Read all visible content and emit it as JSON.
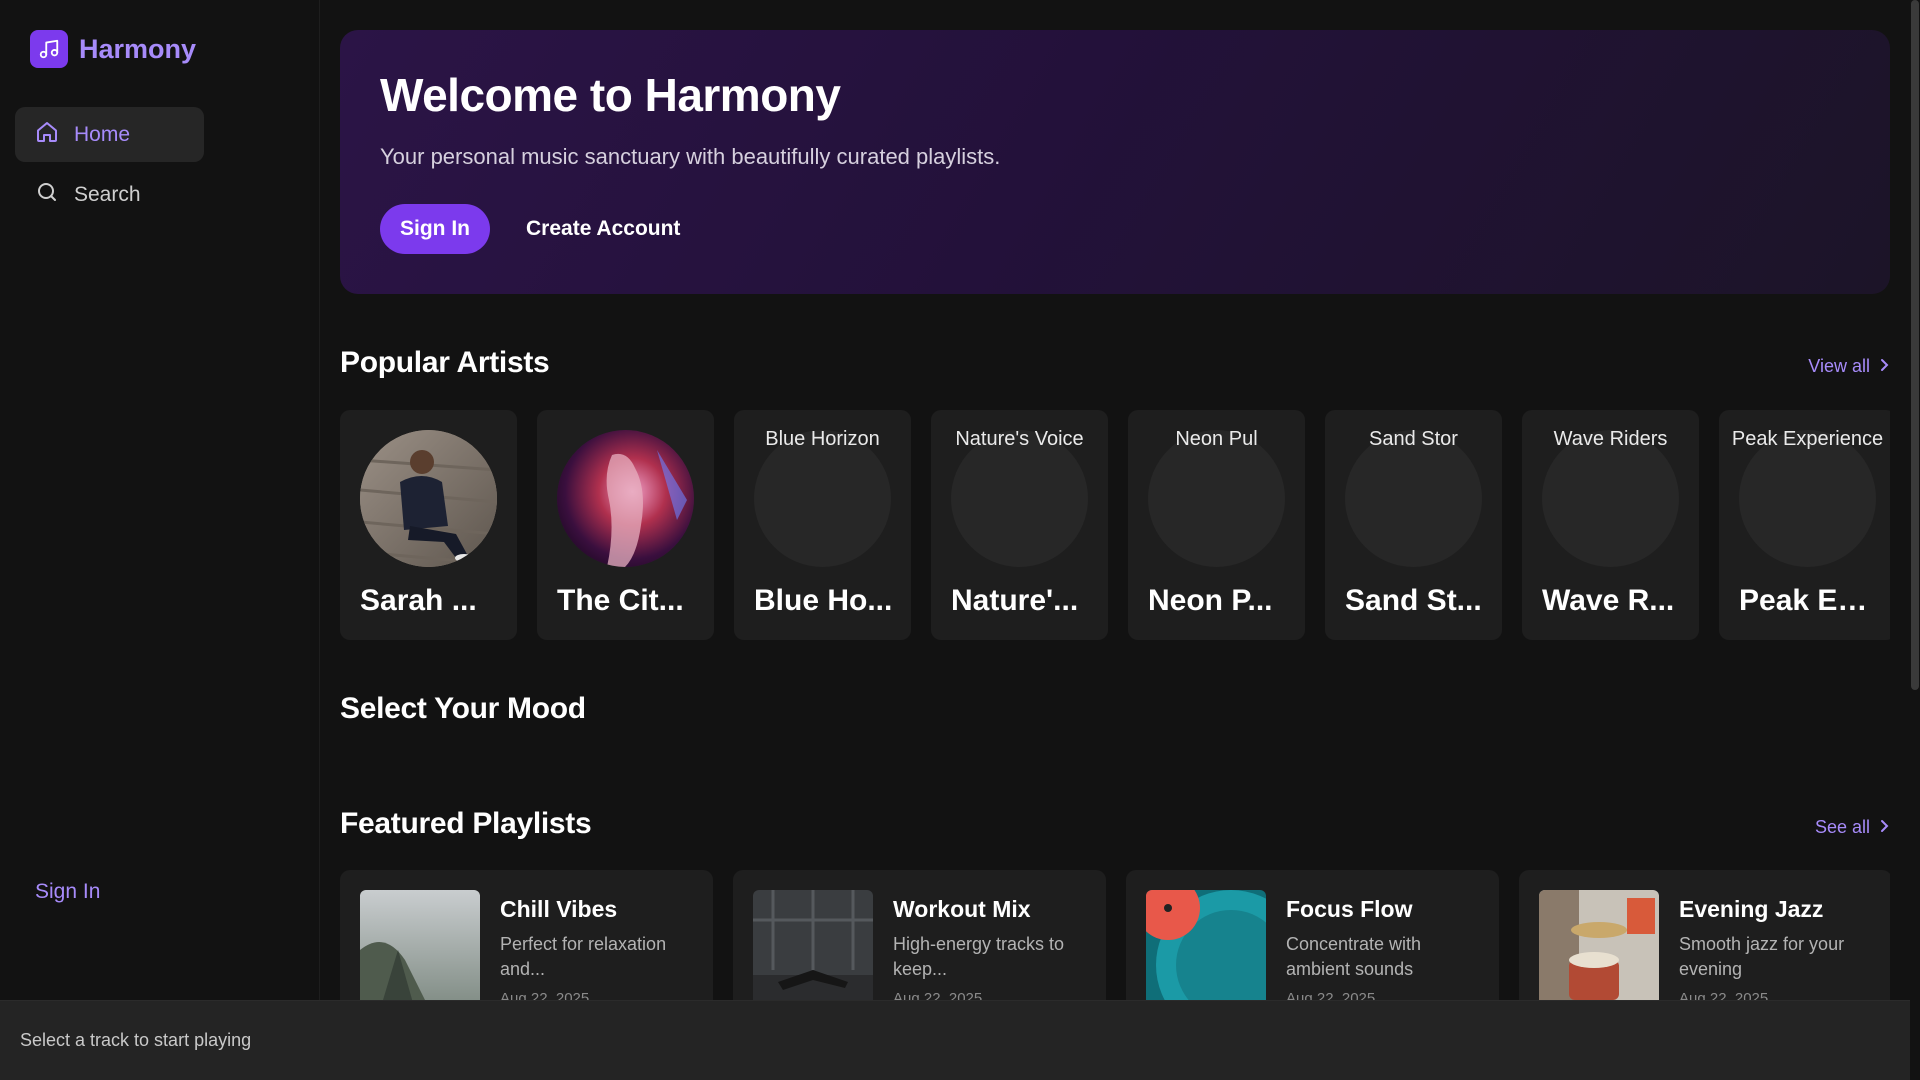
{
  "brand": {
    "name": "Harmony",
    "icon": "music-note-icon",
    "accent": "#7c3aed",
    "accent_light": "#a78bfa"
  },
  "sidebar": {
    "nav": [
      {
        "label": "Home",
        "icon": "home-icon",
        "active": true
      },
      {
        "label": "Search",
        "icon": "search-icon",
        "active": false
      }
    ],
    "signin_label": "Sign In"
  },
  "hero": {
    "title": "Welcome to Harmony",
    "subtitle": "Your personal music sanctuary with beautifully curated playlists.",
    "primary_button": "Sign In",
    "secondary_button": "Create Account"
  },
  "popular_artists": {
    "title": "Popular Artists",
    "link_label": "View all",
    "artists": [
      {
        "name": "Sarah ...",
        "image_alt": "",
        "has_image": true
      },
      {
        "name": "The Cit...",
        "image_alt": "",
        "has_image": true
      },
      {
        "name": "Blue Ho...",
        "image_alt": "Blue Horizon",
        "has_image": false
      },
      {
        "name": "Nature'...",
        "image_alt": "Nature's Voice",
        "has_image": false
      },
      {
        "name": "Neon P...",
        "image_alt": "Neon Pul",
        "has_image": false
      },
      {
        "name": "Sand St...",
        "image_alt": "Sand Stor",
        "has_image": false
      },
      {
        "name": "Wave R...",
        "image_alt": "Wave Riders",
        "has_image": false
      },
      {
        "name": "Peak Ex...",
        "image_alt": "Peak Experience",
        "has_image": false
      }
    ]
  },
  "mood": {
    "title": "Select Your Mood"
  },
  "featured_playlists": {
    "title": "Featured Playlists",
    "link_label": "See all",
    "playlists": [
      {
        "title": "Chill Vibes",
        "desc": "Perfect for relaxation and...",
        "date": "Aug 22, 2025"
      },
      {
        "title": "Workout Mix",
        "desc": "High-energy tracks to keep...",
        "date": "Aug 22, 2025"
      },
      {
        "title": "Focus Flow",
        "desc": "Concentrate with ambient sounds",
        "date": "Aug 22, 2025"
      },
      {
        "title": "Evening Jazz",
        "desc": "Smooth jazz for your evening",
        "date": "Aug 22, 2025"
      }
    ]
  },
  "player": {
    "status": "Select a track to start playing"
  }
}
